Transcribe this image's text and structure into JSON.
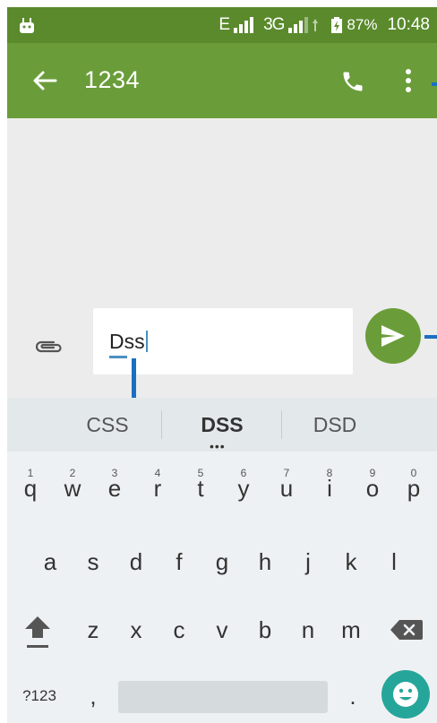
{
  "status_bar": {
    "network_1": "E",
    "network_2": "3G",
    "battery_pct": "87%",
    "time": "10:48",
    "icons": [
      "android-icon",
      "signal-icon",
      "signal-icon",
      "battery-charging-icon"
    ]
  },
  "toolbar": {
    "title": "1234",
    "icons": [
      "back-arrow-icon",
      "phone-icon",
      "more-vert-icon"
    ]
  },
  "compose": {
    "value": "Dss",
    "icons": [
      "paperclip-icon",
      "send-icon"
    ]
  },
  "suggestions": [
    "CSS",
    "DSS",
    "DSD"
  ],
  "keyboard": {
    "row1": [
      {
        "key": "q",
        "hint": "1"
      },
      {
        "key": "w",
        "hint": "2"
      },
      {
        "key": "e",
        "hint": "3"
      },
      {
        "key": "r",
        "hint": "4"
      },
      {
        "key": "t",
        "hint": "5"
      },
      {
        "key": "y",
        "hint": "6"
      },
      {
        "key": "u",
        "hint": "7"
      },
      {
        "key": "i",
        "hint": "8"
      },
      {
        "key": "o",
        "hint": "9"
      },
      {
        "key": "p",
        "hint": "0"
      }
    ],
    "row2": [
      "a",
      "s",
      "d",
      "f",
      "g",
      "h",
      "j",
      "k",
      "l"
    ],
    "row3": [
      "z",
      "x",
      "c",
      "v",
      "b",
      "n",
      "m"
    ],
    "symbols_label": "?123",
    "comma": ",",
    "period": ".",
    "icons": [
      "shift-icon",
      "backspace-icon",
      "emoji-icon"
    ]
  },
  "colors": {
    "toolbar": "#6a9d3a",
    "status_bar": "#5a8a2c",
    "send_button": "#6a9d3a",
    "emoji_button": "#26a69a",
    "annotation": "#1b6fc0"
  }
}
